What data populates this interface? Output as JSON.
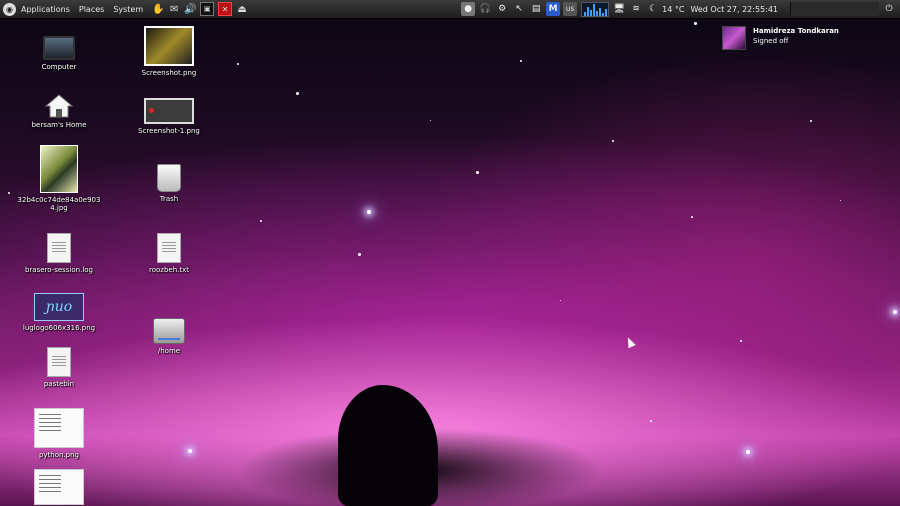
{
  "panel": {
    "menus": [
      "Applications",
      "Places",
      "System"
    ],
    "temperature": "14 °C",
    "clock": "Wed Oct 27, 22:55:41",
    "tray_badge_m": "M",
    "tray_badge_us": "US"
  },
  "notification": {
    "name": "Hamidreza Tondkaran",
    "status": "Signed off"
  },
  "desktop_icons": {
    "computer": "Computer",
    "home": "bersam's Home",
    "photo": "32b4c0c74de84a0e9034.jpg",
    "brasero": "brasero-session.log",
    "lug": "luglogo606x316.png",
    "pastebin": "pastebin",
    "python": "python.png",
    "screenshot": "Screenshot.png",
    "screenshot1": "Screenshot-1.png",
    "trash": "Trash",
    "roozbeh": "roozbeh.txt",
    "home_drive": "/home"
  },
  "colors": {
    "panel_bg": "#2a2a2a",
    "nebula_pink": "#c64ab0",
    "sky_dark": "#0a0612"
  }
}
